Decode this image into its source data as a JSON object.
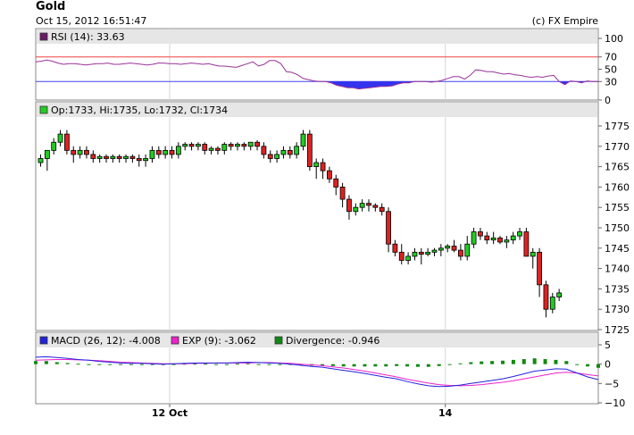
{
  "header": {
    "title": "Gold",
    "timestamp": "Oct 15, 2012 16:51:47",
    "source": "(c) FX Empire"
  },
  "colors": {
    "up": "#22cc22",
    "down": "#dd2222",
    "rsi_line": "#993399",
    "rsi_fill": "#3333ee",
    "level70": "#ee4444",
    "level30": "#4444ee",
    "macd": "#2222dd",
    "exp": "#ee22cc",
    "divergence": "#118811",
    "legend_bg": "#e6e6e6",
    "grid": "#d6d6d6"
  },
  "chart_data": [
    {
      "type": "line",
      "panel": "rsi",
      "legend": "RSI (14): 33.63",
      "ylim": [
        0,
        100
      ],
      "yticks": [
        0,
        30,
        50,
        70,
        100
      ],
      "levels": [
        70,
        30
      ],
      "values": [
        62,
        63,
        65,
        63,
        60,
        58,
        59,
        59,
        58,
        57,
        58,
        59,
        59,
        60,
        58,
        58,
        59,
        60,
        59,
        58,
        57,
        58,
        60,
        60,
        59,
        59,
        58,
        59,
        60,
        59,
        58,
        59,
        57,
        55,
        55,
        54,
        53,
        56,
        59,
        62,
        55,
        58,
        64,
        64,
        59,
        46,
        45,
        41,
        35,
        33,
        31,
        30,
        30,
        28,
        24,
        22,
        20,
        20,
        18,
        19,
        20,
        21,
        22,
        22,
        23,
        26,
        28,
        28,
        30,
        30,
        30,
        29,
        30,
        32,
        35,
        38,
        38,
        34,
        40,
        49,
        48,
        46,
        46,
        44,
        42,
        43,
        41,
        40,
        38,
        37,
        38,
        37,
        39,
        40,
        30,
        25,
        31,
        30,
        28,
        31,
        30,
        30
      ]
    },
    {
      "type": "candlestick",
      "panel": "price",
      "legend": "Op:1733, Hi:1735, Lo:1732, Cl:1734",
      "ylim": [
        1725,
        1780
      ],
      "yticks": [
        1725,
        1730,
        1735,
        1740,
        1745,
        1750,
        1755,
        1760,
        1765,
        1770,
        1775
      ],
      "xticks": [
        {
          "label": "12 Oct",
          "index": 20
        },
        {
          "label": "14",
          "index": 62
        }
      ],
      "candles": [
        [
          1766,
          1768,
          1765,
          1767
        ],
        [
          1767,
          1769,
          1764,
          1769
        ],
        [
          1769,
          1772,
          1768,
          1771
        ],
        [
          1771,
          1774,
          1770,
          1773
        ],
        [
          1773,
          1774,
          1768,
          1769
        ],
        [
          1769,
          1770,
          1766,
          1768
        ],
        [
          1768,
          1770,
          1767,
          1769
        ],
        [
          1769,
          1770,
          1767,
          1768
        ],
        [
          1768,
          1769,
          1766,
          1767
        ],
        [
          1767,
          1768,
          1766,
          1767.5
        ],
        [
          1767.5,
          1768,
          1766,
          1767
        ],
        [
          1767,
          1768,
          1766,
          1767.5
        ],
        [
          1767.5,
          1768,
          1766,
          1767
        ],
        [
          1767,
          1768,
          1766,
          1767.5
        ],
        [
          1767.5,
          1768,
          1766,
          1767
        ],
        [
          1767,
          1768,
          1765,
          1766.5
        ],
        [
          1766.5,
          1768,
          1765,
          1767
        ],
        [
          1767,
          1770,
          1766,
          1769
        ],
        [
          1769,
          1770,
          1767,
          1768
        ],
        [
          1768,
          1770,
          1767,
          1769
        ],
        [
          1769,
          1770,
          1767,
          1768
        ],
        [
          1768,
          1771,
          1767,
          1770
        ],
        [
          1770,
          1771,
          1769,
          1770.5
        ],
        [
          1770.5,
          1771,
          1769,
          1770
        ],
        [
          1770,
          1771,
          1769,
          1770.5
        ],
        [
          1770.5,
          1771,
          1768,
          1769
        ],
        [
          1769,
          1770,
          1768,
          1769.5
        ],
        [
          1769.5,
          1770,
          1768,
          1769
        ],
        [
          1769,
          1771,
          1768,
          1770.5
        ],
        [
          1770.5,
          1771,
          1769,
          1770
        ],
        [
          1770,
          1771,
          1769,
          1770.5
        ],
        [
          1770.5,
          1771,
          1769,
          1770
        ],
        [
          1770,
          1771,
          1769,
          1771
        ],
        [
          1771,
          1771.5,
          1769,
          1770
        ],
        [
          1770,
          1771,
          1767,
          1768
        ],
        [
          1768,
          1769,
          1766,
          1767
        ],
        [
          1767,
          1769,
          1766,
          1768
        ],
        [
          1768,
          1770,
          1767,
          1769
        ],
        [
          1769,
          1770,
          1767,
          1768
        ],
        [
          1768,
          1771,
          1767,
          1770
        ],
        [
          1770,
          1774,
          1769,
          1773
        ],
        [
          1773,
          1774,
          1764,
          1765
        ],
        [
          1765,
          1767,
          1762,
          1766
        ],
        [
          1766,
          1767,
          1762,
          1764
        ],
        [
          1764,
          1765,
          1761,
          1762
        ],
        [
          1762,
          1763,
          1758,
          1760
        ],
        [
          1760,
          1761,
          1755,
          1757
        ],
        [
          1757,
          1758,
          1752,
          1754
        ],
        [
          1754,
          1756,
          1753,
          1755
        ],
        [
          1755,
          1757,
          1754,
          1756
        ],
        [
          1756,
          1757,
          1754,
          1755.5
        ],
        [
          1755.5,
          1756,
          1754,
          1755
        ],
        [
          1755,
          1756,
          1753,
          1754
        ],
        [
          1754,
          1755,
          1744,
          1746
        ],
        [
          1746,
          1747,
          1743,
          1744
        ],
        [
          1744,
          1746,
          1741,
          1742
        ],
        [
          1742,
          1744,
          1741,
          1743
        ],
        [
          1743,
          1745,
          1742,
          1744
        ],
        [
          1744,
          1745,
          1741,
          1743.5
        ],
        [
          1743.5,
          1745,
          1743,
          1744
        ],
        [
          1744,
          1745,
          1743,
          1744.5
        ],
        [
          1744.5,
          1746,
          1743,
          1745
        ],
        [
          1745,
          1746,
          1744,
          1745.5
        ],
        [
          1745.5,
          1747,
          1744,
          1744.5
        ],
        [
          1744.5,
          1746,
          1742,
          1743
        ],
        [
          1743,
          1748,
          1742,
          1746
        ],
        [
          1746,
          1750,
          1745,
          1749
        ],
        [
          1749,
          1750,
          1747,
          1748
        ],
        [
          1748,
          1749,
          1746,
          1747
        ],
        [
          1747,
          1749,
          1746,
          1747.5
        ],
        [
          1747.5,
          1748,
          1746,
          1746.5
        ],
        [
          1746.5,
          1748,
          1745,
          1747
        ],
        [
          1747,
          1749,
          1746,
          1748
        ],
        [
          1748,
          1750,
          1747,
          1749
        ],
        [
          1749,
          1750,
          1744,
          1743
        ],
        [
          1743,
          1745,
          1740,
          1744
        ],
        [
          1744,
          1745,
          1733,
          1736
        ],
        [
          1736,
          1737,
          1728,
          1730
        ],
        [
          1730,
          1734,
          1729,
          1733
        ],
        [
          1733,
          1735,
          1732,
          1734
        ]
      ]
    },
    {
      "type": "line",
      "panel": "macd",
      "legend_macd": "MACD (26, 12): -4.008",
      "legend_exp": "EXP (9): -3.062",
      "legend_div": "Divergence: -0.946",
      "ylim": [
        -10,
        5
      ],
      "yticks": [
        -10,
        -5,
        0,
        5
      ],
      "macd": [
        1.8,
        1.9,
        1.7,
        1.5,
        1.2,
        1.0,
        0.7,
        0.5,
        0.3,
        0.2,
        0.2,
        0.1,
        0.0,
        0.1,
        0.2,
        0.3,
        0.3,
        0.3,
        0.3,
        0.4,
        0.5,
        0.4,
        0.3,
        0.2,
        0.0,
        -0.3,
        -0.6,
        -0.8,
        -1.2,
        -1.6,
        -2.0,
        -2.4,
        -2.9,
        -3.4,
        -3.8,
        -4.5,
        -5.1,
        -5.6,
        -5.8,
        -5.7,
        -5.4,
        -5.0,
        -4.6,
        -4.2,
        -3.8,
        -3.2,
        -2.5,
        -1.8,
        -1.5,
        -1.2,
        -1.3,
        -2.3,
        -3.3,
        -4.008
      ],
      "exp": [
        1.0,
        1.1,
        1.2,
        1.2,
        1.1,
        1.0,
        0.9,
        0.7,
        0.5,
        0.4,
        0.3,
        0.2,
        0.1,
        0.1,
        0.1,
        0.2,
        0.2,
        0.3,
        0.3,
        0.3,
        0.3,
        0.4,
        0.4,
        0.3,
        0.2,
        0.0,
        -0.2,
        -0.4,
        -0.7,
        -1.0,
        -1.4,
        -1.8,
        -2.3,
        -2.8,
        -3.3,
        -3.9,
        -4.4,
        -4.9,
        -5.3,
        -5.5,
        -5.6,
        -5.5,
        -5.3,
        -5.0,
        -4.7,
        -4.3,
        -3.8,
        -3.3,
        -2.8,
        -2.3,
        -2.1,
        -2.3,
        -2.7,
        -3.062
      ],
      "divergence": [
        0.8,
        0.8,
        0.5,
        0.3,
        0.1,
        0,
        -0.2,
        -0.2,
        -0.2,
        -0.2,
        -0.1,
        -0.1,
        -0.1,
        0,
        0.1,
        0.1,
        0.1,
        0,
        0,
        0.1,
        0.2,
        0,
        -0.1,
        -0.1,
        -0.2,
        -0.3,
        -0.4,
        -0.4,
        -0.5,
        -0.6,
        -0.6,
        -0.6,
        -0.6,
        -0.6,
        -0.5,
        -0.6,
        -0.7,
        -0.7,
        -0.5,
        -0.2,
        0.2,
        0.5,
        0.7,
        0.8,
        0.9,
        1.1,
        1.3,
        1.5,
        1.3,
        1.1,
        0.8,
        0,
        -0.6,
        -0.946
      ]
    }
  ]
}
